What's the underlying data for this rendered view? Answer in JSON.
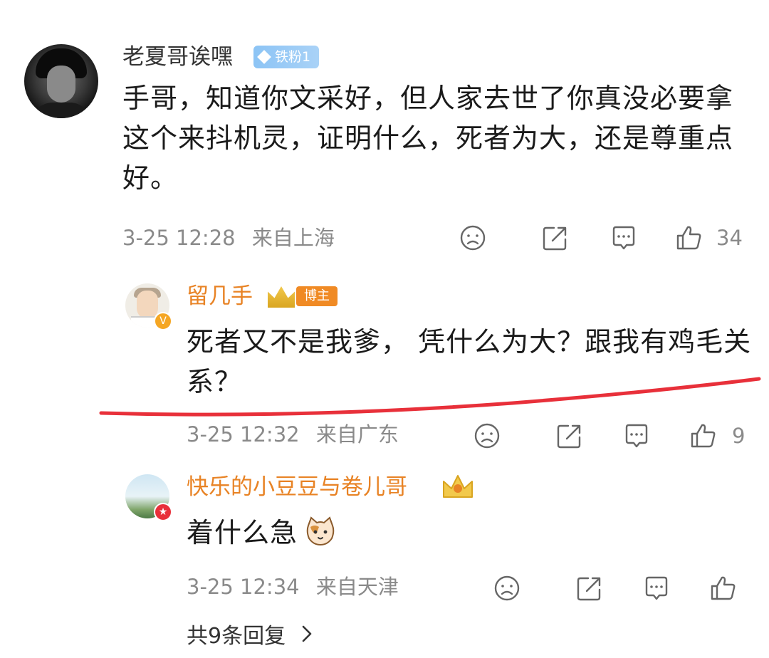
{
  "main_comment": {
    "username": "老夏哥诶嘿",
    "fan_badge": "铁粉1",
    "text": "手哥，知道你文采好，但人家去世了你真没必要拿这个来抖机灵，证明什么，死者为大，还是尊重点好。",
    "date": "3-25 12:28",
    "location": "来自上海",
    "like_count": "34"
  },
  "replies": [
    {
      "username": "留几手",
      "badge": "博主",
      "text": "死者又不是我爹， 凭什么为大？跟我有鸡毛关系？",
      "date": "3-25 12:32",
      "location": "来自广东",
      "like_count": "9"
    },
    {
      "username": "快乐的小豆豆与卷儿哥",
      "text": "着什么急",
      "date": "3-25 12:34",
      "location": "来自天津",
      "like_count": ""
    }
  ],
  "more_replies_label": "共9条回复",
  "icons": {
    "dislike": "sad-face-icon",
    "share": "share-icon",
    "comment": "comment-icon",
    "like": "thumbs-up-icon",
    "more": "chevron-right-icon"
  },
  "colors": {
    "username_highlight": "#e88325",
    "meta_gray": "#8a8a8a",
    "annotation_red": "#e8303a",
    "fan_badge": "#8cc4f5"
  }
}
